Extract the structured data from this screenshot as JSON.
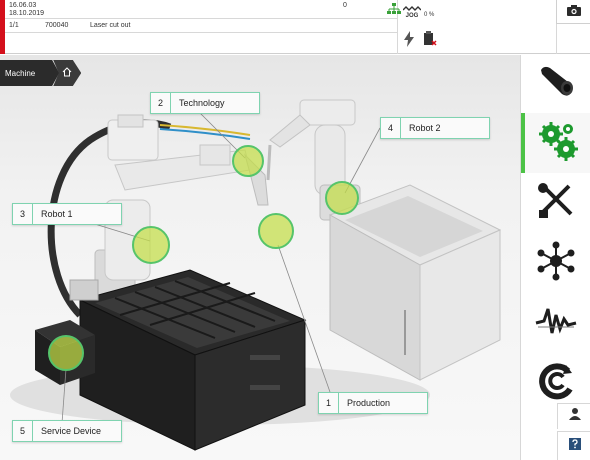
{
  "header": {
    "date1": "16.06.03",
    "date2": "18.10.2019",
    "counter": "0",
    "job_count": "1/1",
    "program_number": "700040",
    "program_name": "Laser cut out",
    "jog_percent": "0 %",
    "jog_label": "JOG"
  },
  "breadcrumb": {
    "items": [
      {
        "label": "Machine"
      }
    ]
  },
  "callouts": [
    {
      "number": "1",
      "label": "Production"
    },
    {
      "number": "2",
      "label": "Technology"
    },
    {
      "number": "3",
      "label": "Robot 1"
    },
    {
      "number": "4",
      "label": "Robot 2"
    },
    {
      "number": "5",
      "label": "Service Device"
    }
  ],
  "colors": {
    "accent_green": "#4cc246",
    "alarm_red": "#d4101c",
    "hotspot_fill": "#c4de46"
  },
  "toolbar": {
    "items": [
      {
        "icon": "tube-icon"
      },
      {
        "icon": "gears-icon",
        "active": true
      },
      {
        "icon": "tools-icon"
      },
      {
        "icon": "network-icon"
      },
      {
        "icon": "signal-wave-icon"
      },
      {
        "icon": "cycle-icon"
      },
      {
        "icon": "user-icon"
      },
      {
        "icon": "help-icon"
      }
    ]
  }
}
